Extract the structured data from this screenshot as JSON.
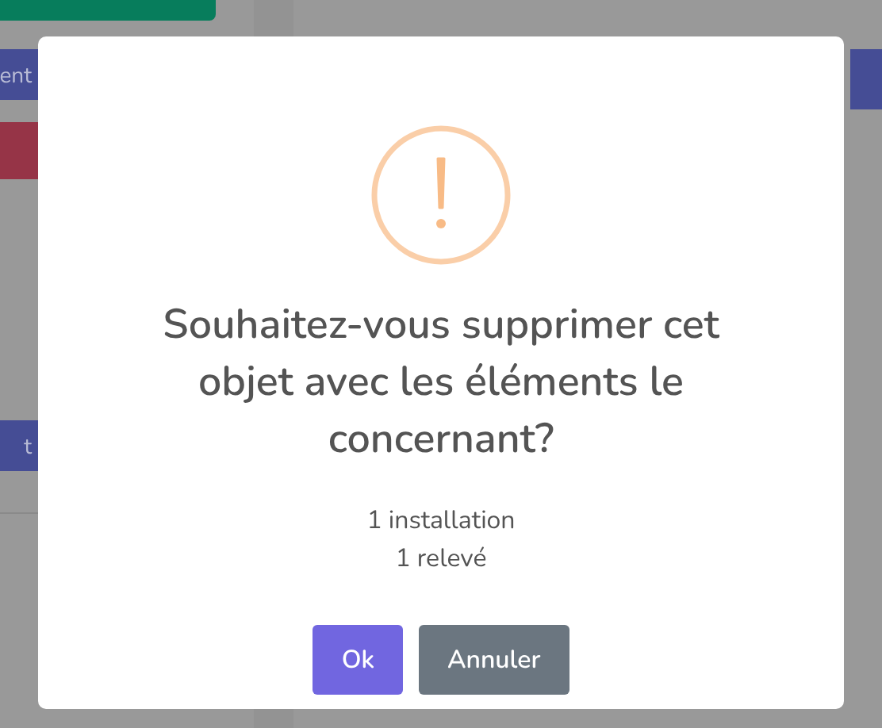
{
  "background": {
    "buttons": [
      {
        "kind": "success"
      },
      {
        "kind": "primary",
        "label": "ent"
      },
      {
        "kind": "danger"
      },
      {
        "kind": "primary",
        "label": "t"
      }
    ]
  },
  "dialog": {
    "title": "Souhaitez-vous supprimer cet objet avec les éléments le concernant?",
    "items": [
      "1 installation",
      "1 relevé"
    ],
    "buttons": [
      {
        "kind": "confirm",
        "label": "Ok"
      },
      {
        "kind": "cancel",
        "label": "Annuler"
      }
    ]
  }
}
